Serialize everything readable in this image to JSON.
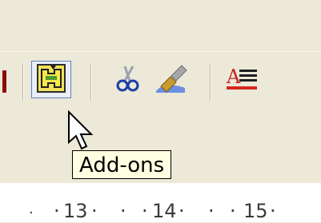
{
  "toolbar": {
    "buttons": [
      {
        "name": "Add-ons",
        "icon": "puzzle-piece-icon",
        "highlighted": true
      },
      {
        "name": "cut",
        "icon": "scissors-icon"
      },
      {
        "name": "format-paintbrush",
        "icon": "paintbrush-icon"
      },
      {
        "name": "text-underline",
        "icon": "text-underline-icon"
      }
    ]
  },
  "tooltip": {
    "text": "Add-ons"
  },
  "ruler": {
    "ticks": [
      "13",
      "14",
      "15"
    ]
  },
  "colors": {
    "highlight_border": "#5e7fc2",
    "tooltip_bg": "#ffffe1",
    "underline_red": "#d3281f"
  }
}
